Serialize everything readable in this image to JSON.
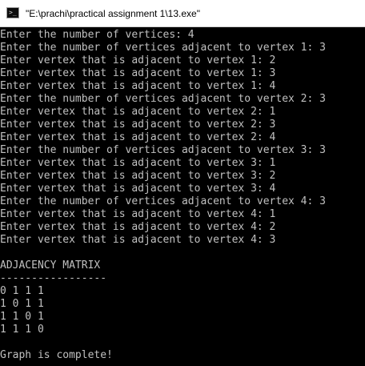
{
  "window": {
    "title": "\"E:\\prachi\\practical assignment 1\\13.exe\"",
    "icon": "console-app-icon",
    "icon_glyph": ">_"
  },
  "console": {
    "background": "#000000",
    "foreground": "#c0c0c0",
    "lines": [
      "Enter the number of vertices: 4",
      "Enter the number of vertices adjacent to vertex 1: 3",
      "Enter vertex that is adjacent to vertex 1: 2",
      "Enter vertex that is adjacent to vertex 1: 3",
      "Enter vertex that is adjacent to vertex 1: 4",
      "Enter the number of vertices adjacent to vertex 2: 3",
      "Enter vertex that is adjacent to vertex 2: 1",
      "Enter vertex that is adjacent to vertex 2: 3",
      "Enter vertex that is adjacent to vertex 2: 4",
      "Enter the number of vertices adjacent to vertex 3: 3",
      "Enter vertex that is adjacent to vertex 3: 1",
      "Enter vertex that is adjacent to vertex 3: 2",
      "Enter vertex that is adjacent to vertex 3: 4",
      "Enter the number of vertices adjacent to vertex 4: 3",
      "Enter vertex that is adjacent to vertex 4: 1",
      "Enter vertex that is adjacent to vertex 4: 2",
      "Enter vertex that is adjacent to vertex 4: 3",
      "",
      "ADJACENCY MATRIX",
      "-----------------",
      "0 1 1 1",
      "1 0 1 1",
      "1 1 0 1",
      "1 1 1 0",
      "",
      "Graph is complete!"
    ]
  }
}
